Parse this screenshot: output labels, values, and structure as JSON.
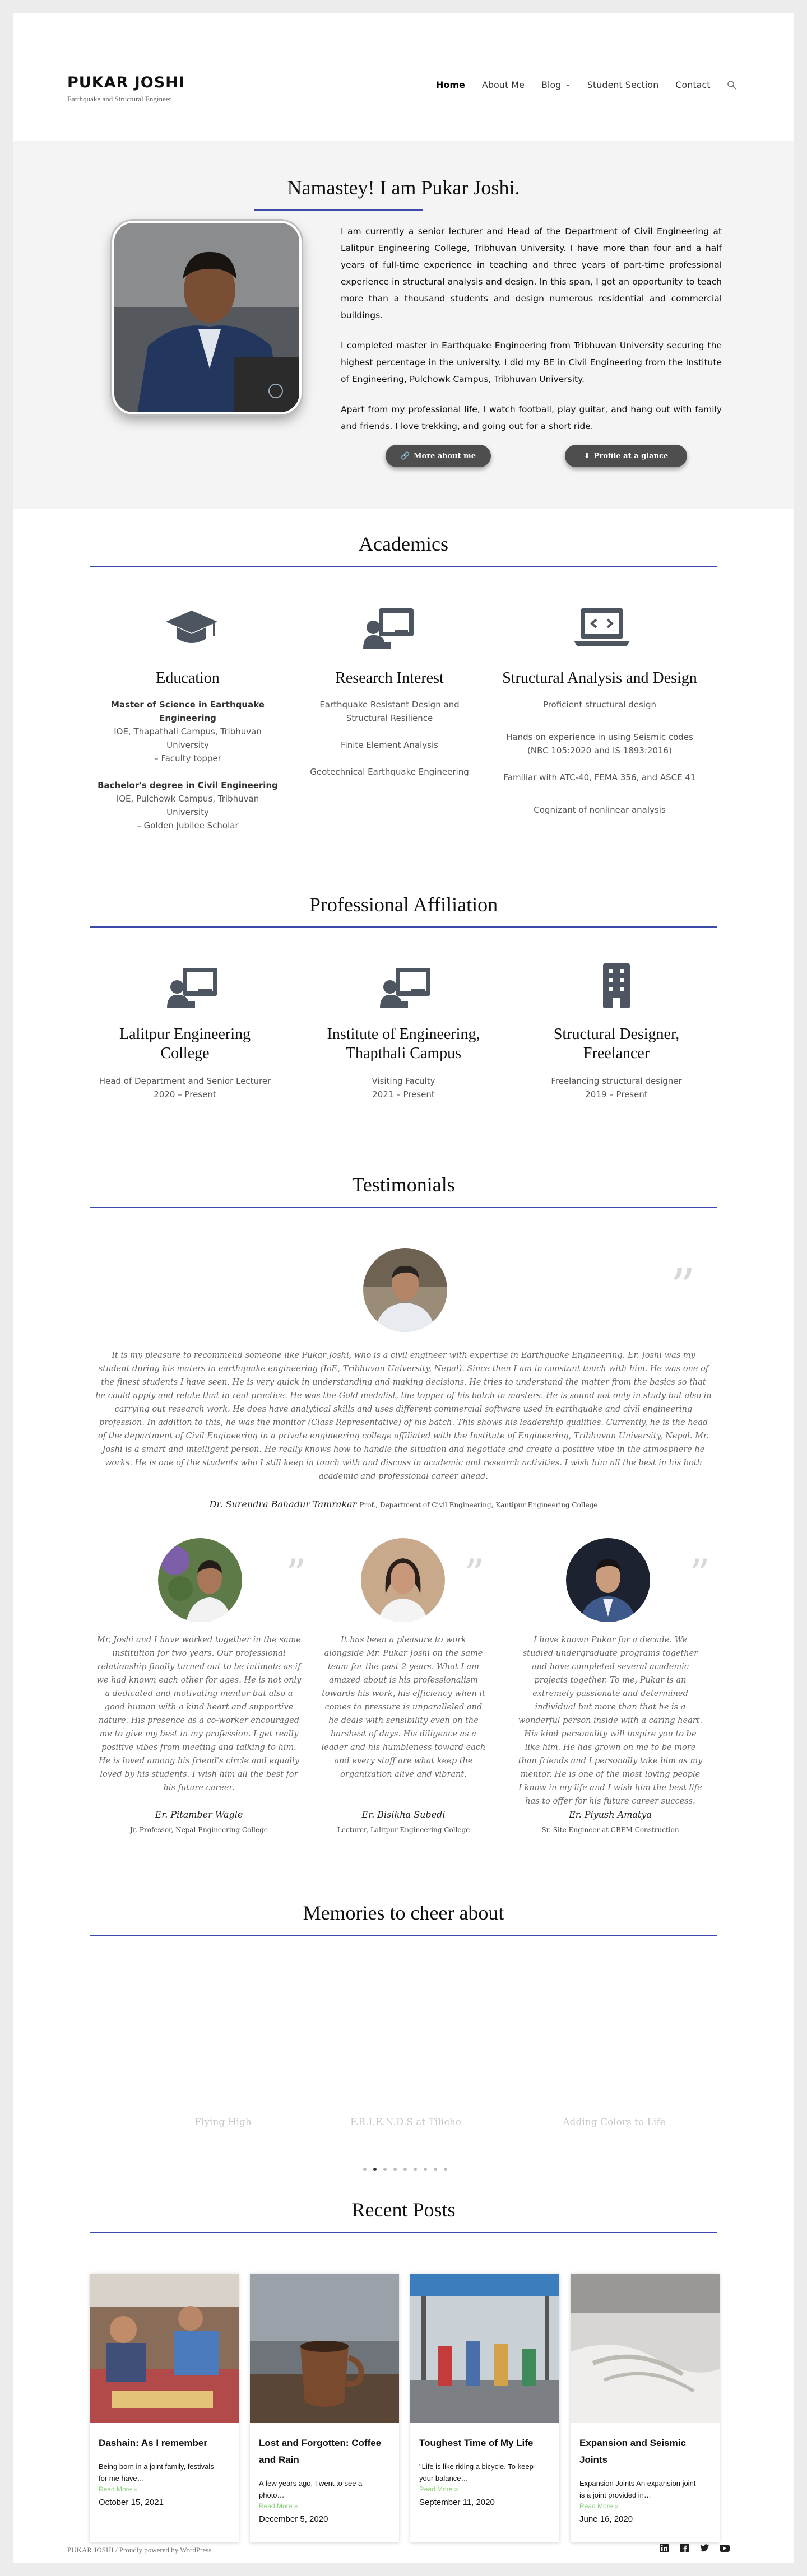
{
  "site": {
    "title": "PUKAR JOSHI",
    "tagline": "Earthquake and Structural Engineer"
  },
  "nav": {
    "items": [
      "Home",
      "About Me",
      "Blog",
      "Student Section",
      "Contact"
    ],
    "search_icon": "search-icon"
  },
  "hero": {
    "heading": "Namastey! I am Pukar Joshi.",
    "paragraphs": [
      "I am currently a senior lecturer and Head of the Department of Civil Engineering at Lalitpur Engineering College, Tribhuvan University. I have more than four and a half years of full-time experience in teaching and three years of part-time professional experience in structural analysis and design. In this span, I got an opportunity to teach more than a thousand students and design numerous residential and commercial buildings.",
      "I completed master in Earthquake Engineering from Tribhuvan University securing the highest percentage in the university. I did my BE in Civil Engineering from the Institute of Engineering, Pulchowk Campus, Tribhuvan University.",
      "Apart from my professional life, I watch football, play guitar, and hang out with family and friends. I love trekking, and going out for a short ride."
    ],
    "btn_more": "More about me",
    "btn_profile": "Profile at a glance"
  },
  "academics": {
    "heading": "Academics",
    "cols": [
      {
        "title": "Education",
        "lines": [
          "Master of Science in Earthquake Engineering",
          "IOE, Thapathali Campus, Tribhuvan University",
          "– Faculty topper",
          "Bachelor's degree in Civil Engineering",
          "IOE, Pulchowk Campus, Tribhuvan University",
          "– Golden Jubilee Scholar"
        ]
      },
      {
        "title": "Research Interest",
        "lines": [
          "Earthquake Resistant Design and",
          "Structural Resilience",
          "Finite Element Analysis",
          "Geotechnical Earthquake Engineering"
        ]
      },
      {
        "title": "Structural Analysis and Design",
        "lines": [
          "Proficient structural design",
          "Hands on experience in using Seismic codes",
          "(NBC 105:2020 and IS 1893:2016)",
          "Familiar with ATC-40, FEMA 356, and ASCE 41",
          "Cognizant of nonlinear analysis"
        ]
      }
    ]
  },
  "affiliation": {
    "heading": "Professional Affiliation",
    "cols": [
      {
        "title1": "Lalitpur Engineering",
        "title2": "College",
        "role": "Head of Department and Senior Lecturer",
        "period": "2020 – Present"
      },
      {
        "title1": "Institute of Engineering,",
        "title2": "Thapthali Campus",
        "role": "Visiting Faculty",
        "period": "2021 – Present"
      },
      {
        "title1": "Structural Designer,",
        "title2": "Freelancer",
        "role": "Freelancing structural designer",
        "period": "2019 – Present"
      }
    ]
  },
  "testimonials": {
    "heading": "Testimonials",
    "main": {
      "text": "It is my pleasure to recommend someone like Pukar Joshi, who is a civil engineer with expertise in Earthquake Engineering. Er. Joshi was my student during his maters in earthquake engineering (IoE, Tribhuvan University, Nepal). Since then I am in constant touch with him. He was one of the finest students I have seen. He is very quick in understanding and making decisions. He tries to understand the matter from the basics so that he could apply and relate that in real practice. He was the Gold medalist, the topper of his batch in masters. He is sound not only in study but also in carrying out research work. He does have analytical skills and uses different commercial software used in earthquake and civil engineering profession. In addition to this, he was the monitor (Class Representative) of his batch. This shows his leadership qualities. Currently, he is the head of the department of Civil Engineering in a private engineering college affiliated with the Institute of Engineering, Tribhuvan University, Nepal. Mr. Joshi is a smart and intelligent person. He really knows how to handle the situation and negotiate and create a positive vibe in the atmosphere he works. He is one of the students who I still keep in touch with and discuss in academic and research activities. I wish him all the best in his both academic and professional career ahead.",
      "name": "Dr. Surendra Bahadur Tamrakar",
      "role": "Prof., Department of Civil Engineering, Kantipur Engineering College"
    },
    "others": [
      {
        "text": "Mr. Joshi and I have worked together in the same institution for two years. Our professional relationship finally turned out to be intimate as if we had known each other for ages. He is not only a dedicated and motivating mentor but also a good human with a kind heart and supportive nature. His presence as a co-worker encouraged me to give my best in my profession. I get really positive vibes from meeting and talking to him. He is loved among his friend's circle and equally loved by his students. I wish him all the best for his future career.",
        "name": "Er. Pitamber Wagle",
        "role": "Jr. Professor, Nepal Engineering College"
      },
      {
        "text": "It has been a pleasure to work alongside Mr. Pukar Joshi on the same team for the past 2 years. What I am amazed about is his professionalism towards his work, his efficiency when it comes to pressure is unparalleled and he deals with sensibility even on the harshest of days. His diligence as a leader and his humbleness toward each and every staff are what keep the organization alive and vibrant.",
        "name": "Er. Bisikha Subedi",
        "role": "Lecturer, Lalitpur Engineering College"
      },
      {
        "text": "I have known Pukar for a decade. We studied undergraduate programs together and have completed several academic projects together. To me, Pukar is an extremely passionate and determined individual but more than that he is a wonderful person inside with a caring heart. His kind personality will inspire you to be like him. He has grown on me to be more than friends and I personally take him as my mentor. He is one of the most loving people I know in my life and I wish him the best life has to offer for his future career success.",
        "name": "Er. Piyush Amatya",
        "role": "Sr. Site Engineer at CBEM Construction"
      }
    ]
  },
  "memories": {
    "heading": "Memories to cheer about",
    "captions": [
      "Flying High",
      "F.R.I.E.N.D.S at Tilicho",
      "Adding Colors to Life"
    ]
  },
  "posts": {
    "heading": "Recent Posts",
    "items": [
      {
        "title1": "Dashain: As I remember",
        "title2": "",
        "excerpt1": "Being born in a joint family, festivals",
        "excerpt2": "for me have…",
        "more": "Read More »",
        "date": "October 15, 2021"
      },
      {
        "title1": "Lost and Forgotten: Coffee",
        "title2": "and Rain",
        "excerpt1": "A few years ago, I went to see a",
        "excerpt2": "photo…",
        "more": "Read More »",
        "date": "December 5, 2020"
      },
      {
        "title1": "Toughest Time of My Life",
        "title2": "",
        "excerpt1": "\"Life is like riding a bicycle. To keep",
        "excerpt2": "your balance…",
        "more": "Read More »",
        "date": "September 11, 2020"
      },
      {
        "title1": "Expansion and Seismic",
        "title2": "Joints",
        "excerpt1": "Expansion Joints An expansion joint",
        "excerpt2": "is a joint provided in…",
        "more": "Read More »",
        "date": "June 16, 2020"
      }
    ]
  },
  "footer": {
    "text": "PUKAR JOSHI  /  Proudly powered by WordPress",
    "social": [
      "linkedin-icon",
      "facebook-icon",
      "twitter-icon",
      "youtube-icon"
    ]
  },
  "colors": {
    "accent_rule": "#3b4aa8",
    "readmore": "#8bd17c",
    "button": "#4e4e4e"
  }
}
